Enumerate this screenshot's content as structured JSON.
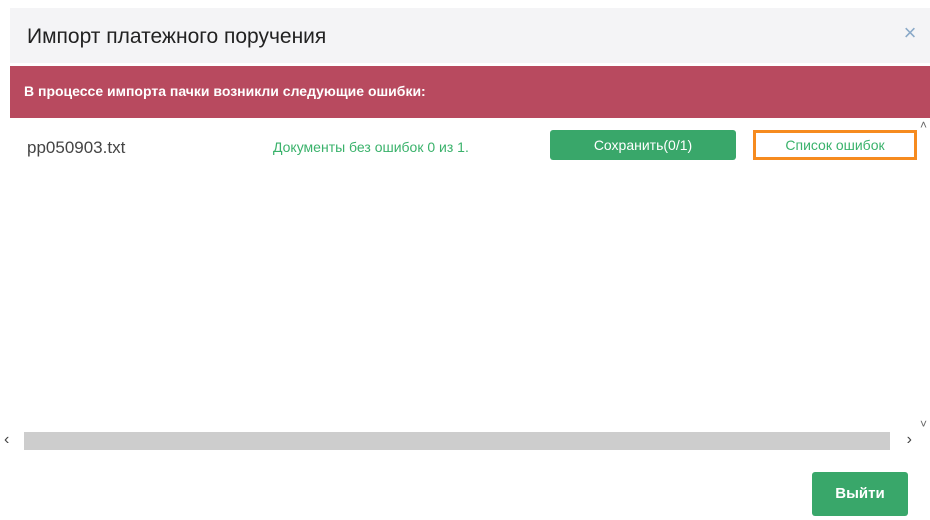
{
  "dialog": {
    "title": "Импорт платежного поручения",
    "close_icon": "×"
  },
  "banner": {
    "text": "В процессе импорта пачки возникли следующие ошибки:",
    "color": "#b84a5f"
  },
  "file_row": {
    "filename": "pp050903.txt",
    "status": "Документы без ошибок 0 из 1.",
    "save_label": "Сохранить(0/1)",
    "errors_label": "Список ошибок"
  },
  "scrollbars": {
    "left_arrow": "‹",
    "right_arrow": "›",
    "up_arrow": "˄",
    "down_arrow": "˅"
  },
  "footer": {
    "exit_label": "Выйти"
  },
  "colors": {
    "accent_green": "#39a76a",
    "highlight_orange": "#f68b1f"
  }
}
